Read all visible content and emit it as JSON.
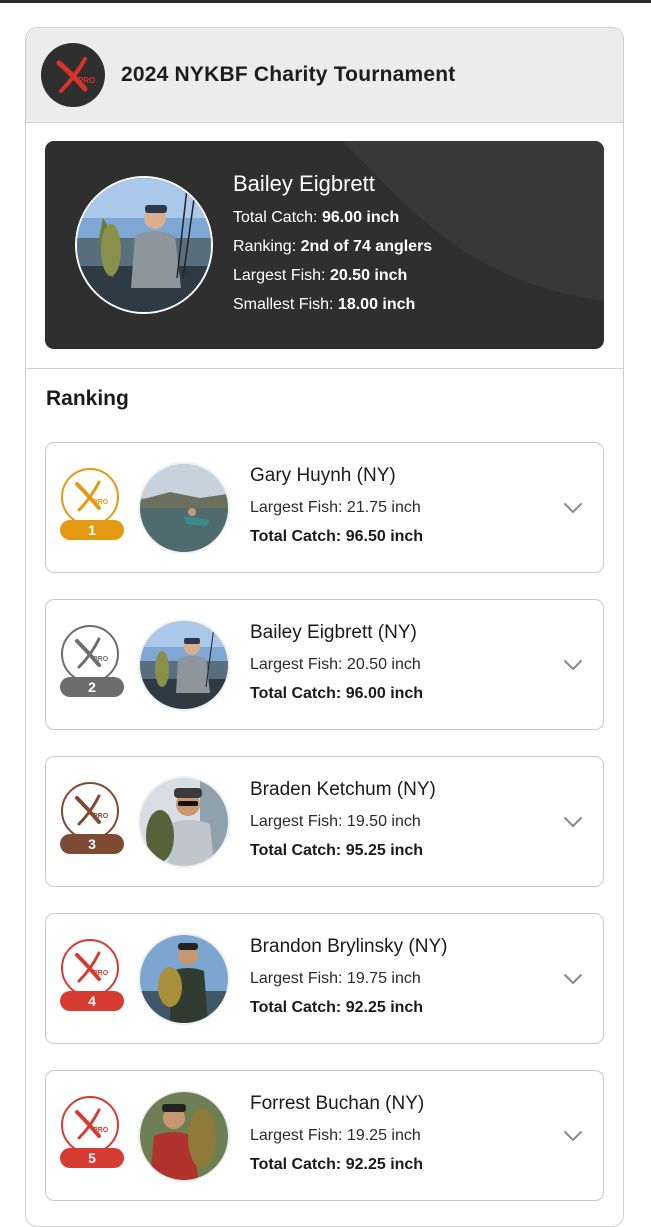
{
  "header": {
    "title": "2024 NYKBF Charity Tournament",
    "logo_icon": "xpro-logo-icon"
  },
  "profile": {
    "name": "Bailey Eigbrett",
    "total_catch_label": "Total Catch:",
    "total_catch_value": "96.00 inch",
    "ranking_label": "Ranking:",
    "ranking_value": "2nd of 74 anglers",
    "largest_label": "Largest Fish:",
    "largest_value": "20.50 inch",
    "smallest_label": "Smallest Fish:",
    "smallest_value": "18.00 inch"
  },
  "ranking": {
    "title": "Ranking",
    "items": [
      {
        "rank": "1",
        "name": "Gary Huynh (NY)",
        "largest": "Largest Fish: 21.75 inch",
        "total": "Total Catch: 96.50 inch"
      },
      {
        "rank": "2",
        "name": "Bailey Eigbrett (NY)",
        "largest": "Largest Fish: 20.50 inch",
        "total": "Total Catch: 96.00 inch"
      },
      {
        "rank": "3",
        "name": "Braden Ketchum (NY)",
        "largest": "Largest Fish: 19.50 inch",
        "total": "Total Catch: 95.25 inch"
      },
      {
        "rank": "4",
        "name": "Brandon Brylinsky (NY)",
        "largest": "Largest Fish: 19.75 inch",
        "total": "Total Catch: 92.25 inch"
      },
      {
        "rank": "5",
        "name": "Forrest Buchan (NY)",
        "largest": "Largest Fish: 19.25 inch",
        "total": "Total Catch: 92.25 inch"
      }
    ]
  },
  "colors": {
    "gold": "#e39a12",
    "silver": "#6d6d6d",
    "bronze": "#7f4a33",
    "red": "#d63b32",
    "profile_bg": "#2f2f2f",
    "header_bg": "#ececec"
  }
}
